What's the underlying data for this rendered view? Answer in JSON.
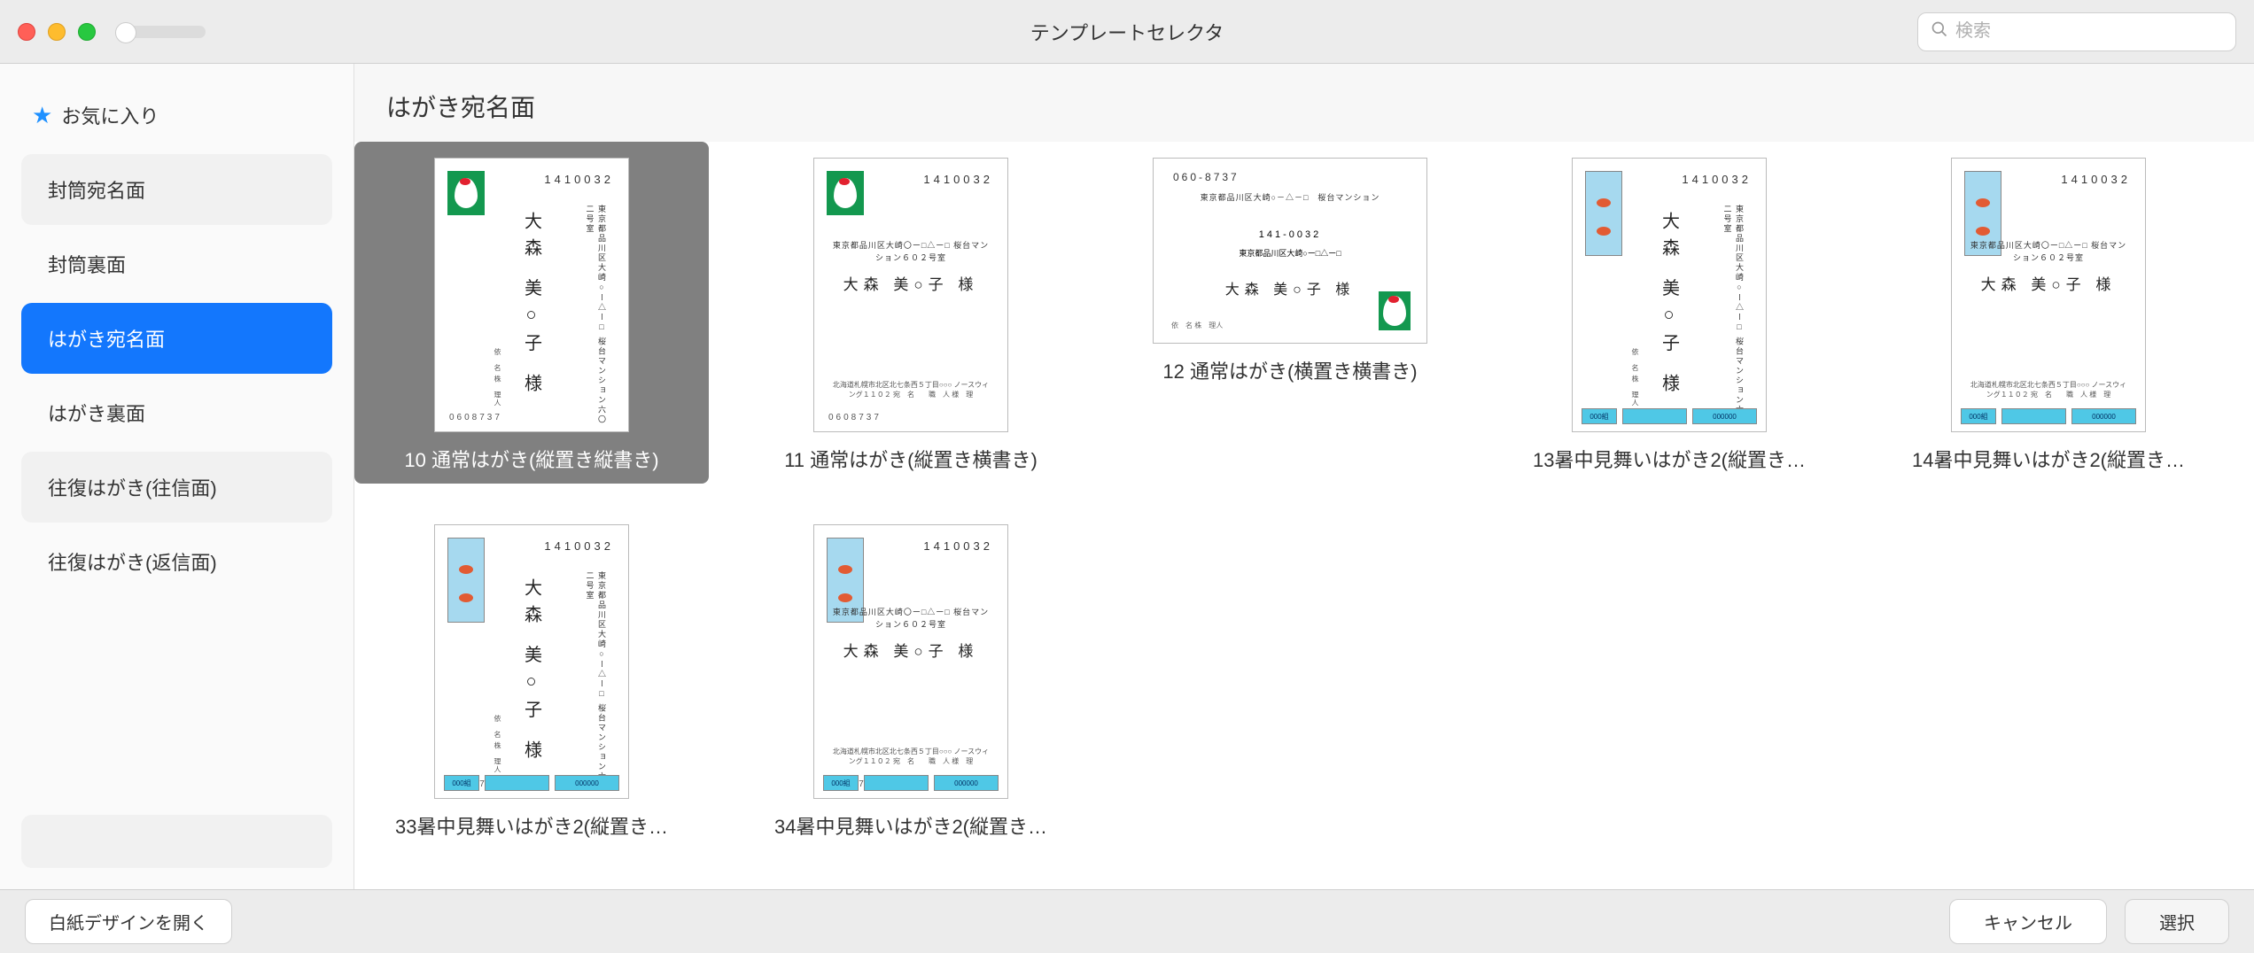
{
  "window_title": "テンプレートセレクタ",
  "search": {
    "placeholder": "検索"
  },
  "sidebar": {
    "favorites_label": "お気に入り",
    "items": [
      {
        "label": "封筒宛名面"
      },
      {
        "label": "封筒裏面"
      },
      {
        "label": "はがき宛名面"
      },
      {
        "label": "はがき裏面"
      },
      {
        "label": "往復はがき(往信面)"
      },
      {
        "label": "往復はがき(返信面)"
      }
    ],
    "selected_index": 2
  },
  "content": {
    "header": "はがき宛名面",
    "selected_index": 0,
    "templates": [
      {
        "label": "10 通常はがき(縦置き縦書き)",
        "orientation": "portrait",
        "style": "vertical",
        "theme": "crane"
      },
      {
        "label": "11 通常はがき(縦置き横書き)",
        "orientation": "portrait",
        "style": "horizontal",
        "theme": "crane"
      },
      {
        "label": "12 通常はがき(横置き横書き)",
        "orientation": "landscape",
        "style": "horizontal",
        "theme": "crane"
      },
      {
        "label": "13暑中見舞いはがき2(縦置き…",
        "orientation": "portrait",
        "style": "vertical",
        "theme": "goldfish"
      },
      {
        "label": "14暑中見舞いはがき2(縦置き…",
        "orientation": "portrait",
        "style": "horizontal",
        "theme": "goldfish"
      },
      {
        "label": "33暑中見舞いはがき2(縦置き…",
        "orientation": "portrait",
        "style": "vertical",
        "theme": "goldfish"
      },
      {
        "label": "34暑中見舞いはがき2(縦置き…",
        "orientation": "portrait",
        "style": "horizontal",
        "theme": "goldfish"
      }
    ],
    "thumb_text": {
      "recipient_zip": "1410032",
      "recipient_name": "大森 美○子 様",
      "recipient_name_h": "大森 美○子 様",
      "recipient_addr_v": "東京都品川区大崎○ー△ー□\n桜台マンション六〇二号室",
      "recipient_addr_h": "東京都品川区大崎〇ー□△ー□\n桜台マンション６０２号室",
      "landscape_zip1": "060-8737",
      "landscape_addr1": "東京都品川区大崎○－△－□　桜台マンション",
      "landscape_zip2": "141-0032",
      "landscape_addr2": "東京都品川区大崎○ー□△ー□",
      "sender_zip": "0608737",
      "sender_note": "依　名\n株　理人",
      "sender_h": "北海道札幌市北区北七条西５丁目○○○\nノースウィング１１０２\n宛　名　　職　人\n様　理",
      "bluebar_left": "000組",
      "bluebar_right": "000000"
    }
  },
  "footer": {
    "blank_design": "白紙デザインを開く",
    "cancel": "キャンセル",
    "select": "選択"
  }
}
